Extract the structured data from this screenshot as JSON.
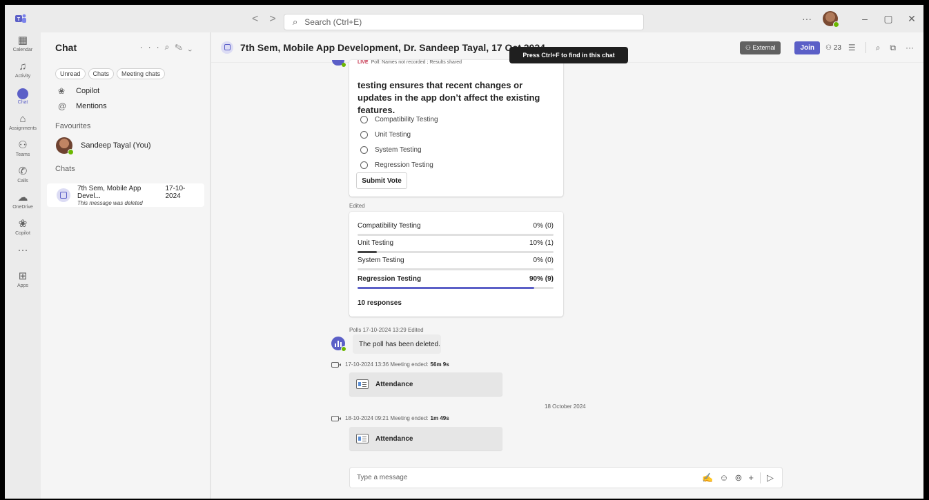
{
  "titlebar": {
    "search_placeholder": "Search (Ctrl+E)",
    "nav_back": "<",
    "nav_forward": ">",
    "more": "···",
    "minimize": "–",
    "restore": "▢",
    "close": "✕"
  },
  "rail": [
    {
      "label": "Calendar",
      "icon": "calendar-icon"
    },
    {
      "label": "Activity",
      "icon": "bell-icon"
    },
    {
      "label": "Chat",
      "icon": "chat-icon",
      "active": true
    },
    {
      "label": "Assignments",
      "icon": "assignments-icon"
    },
    {
      "label": "Teams",
      "icon": "teams-icon"
    },
    {
      "label": "Calls",
      "icon": "phone-icon"
    },
    {
      "label": "OneDrive",
      "icon": "cloud-icon"
    },
    {
      "label": "Copilot",
      "icon": "copilot-icon"
    },
    {
      "label": "Apps",
      "icon": "plus-square-icon"
    }
  ],
  "rail_more": "···",
  "sidebar": {
    "title": "Chat",
    "filters": [
      "Unread",
      "Chats",
      "Meeting chats"
    ],
    "pinned": [
      {
        "label": "Copilot",
        "icon": "copilot-icon"
      },
      {
        "label": "Mentions",
        "icon": "at-icon"
      }
    ],
    "favourites_label": "Favourites",
    "favourite": "Sandeep Tayal (You)",
    "chats_label": "Chats",
    "chat_item": {
      "title": "7th Sem, Mobile App Devel...",
      "date": "17-10-2024",
      "subtitle": "This message was deleted"
    }
  },
  "header": {
    "title": "7th Sem, Mobile App Development, Dr. Sandeep Tayal, 17 Oct 2024",
    "external": "External",
    "join": "Join",
    "participants": "23"
  },
  "tooltip": "Press Ctrl+F to find in this chat",
  "poll": {
    "live": "LIVE",
    "live_meta": "Poll: Names not recorded ; Results shared",
    "question": "testing ensures that recent changes or updates in the app don’t affect the existing features.",
    "options": [
      "Compatibility Testing",
      "Unit Testing",
      "System Testing",
      "Regression Testing"
    ],
    "submit": "Submit Vote"
  },
  "edited_label": "Edited",
  "results": {
    "rows": [
      {
        "label": "Compatibility Testing",
        "value": "0% (0)",
        "fraction": 0.0
      },
      {
        "label": "Unit Testing",
        "value": "10% (1)",
        "fraction": 0.1
      },
      {
        "label": "System Testing",
        "value": "0% (0)",
        "fraction": 0.0
      },
      {
        "label": "Regression Testing",
        "value": "90% (9)",
        "fraction": 0.9,
        "winner": true
      }
    ],
    "responses": "10 responses"
  },
  "polls_meta": "Polls  17-10-2024 13:29  Edited",
  "deleted_text": "The poll has been deleted.",
  "meetings": [
    {
      "time": "17-10-2024 13:36  Meeting ended:",
      "duration": "56m 9s",
      "attachment": "Attendance"
    },
    {
      "time": "18-10-2024 09:21  Meeting ended:",
      "duration": "1m 49s",
      "attachment": "Attendance"
    }
  ],
  "date_separator": "18 October 2024",
  "compose": {
    "placeholder": "Type a message"
  },
  "colors": {
    "accent": "#5b5fc7",
    "presence": "#6bb700",
    "live": "#c4314b"
  }
}
